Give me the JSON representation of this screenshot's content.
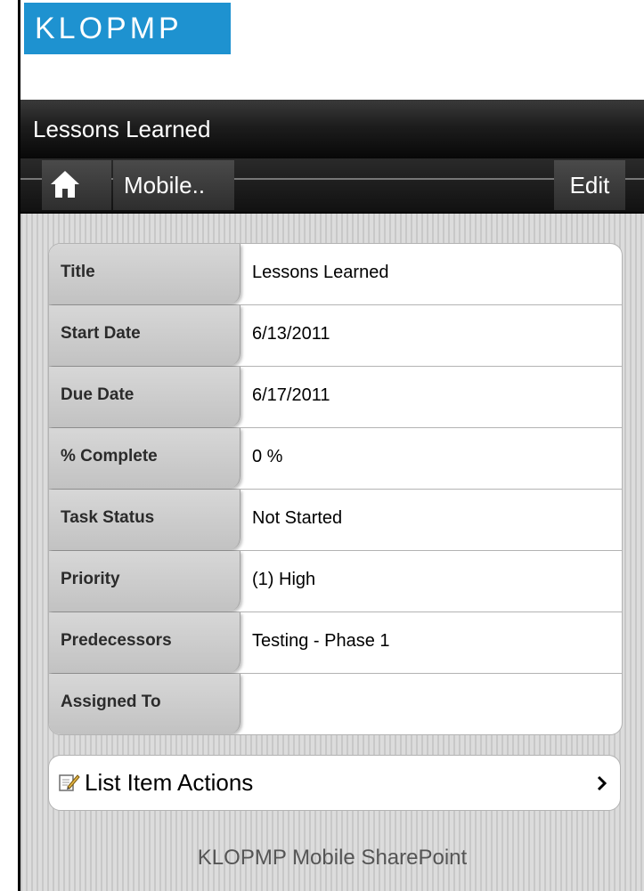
{
  "logo": {
    "text": "KLOPMP",
    "bg_color": "#1e92d0"
  },
  "title_bar": {
    "title": "Lessons Learned"
  },
  "toolbar": {
    "home_icon": "home-icon",
    "back_label": "Mobile..",
    "edit_label": "Edit"
  },
  "details": {
    "rows": [
      {
        "label": "Title",
        "value": "Lessons Learned"
      },
      {
        "label": "Start Date",
        "value": "6/13/2011"
      },
      {
        "label": "Due Date",
        "value": "6/17/2011"
      },
      {
        "label": "% Complete",
        "value": "0 %"
      },
      {
        "label": "Task Status",
        "value": "Not Started"
      },
      {
        "label": "Priority",
        "value": "(1) High"
      },
      {
        "label": "Predecessors",
        "value": "Testing - Phase 1"
      },
      {
        "label": "Assigned To",
        "value": ""
      }
    ]
  },
  "actions": {
    "icon": "edit-icon",
    "label": "List Item Actions",
    "chevron": "chevron-right-icon"
  },
  "footer": {
    "text": "KLOPMP Mobile SharePoint"
  }
}
